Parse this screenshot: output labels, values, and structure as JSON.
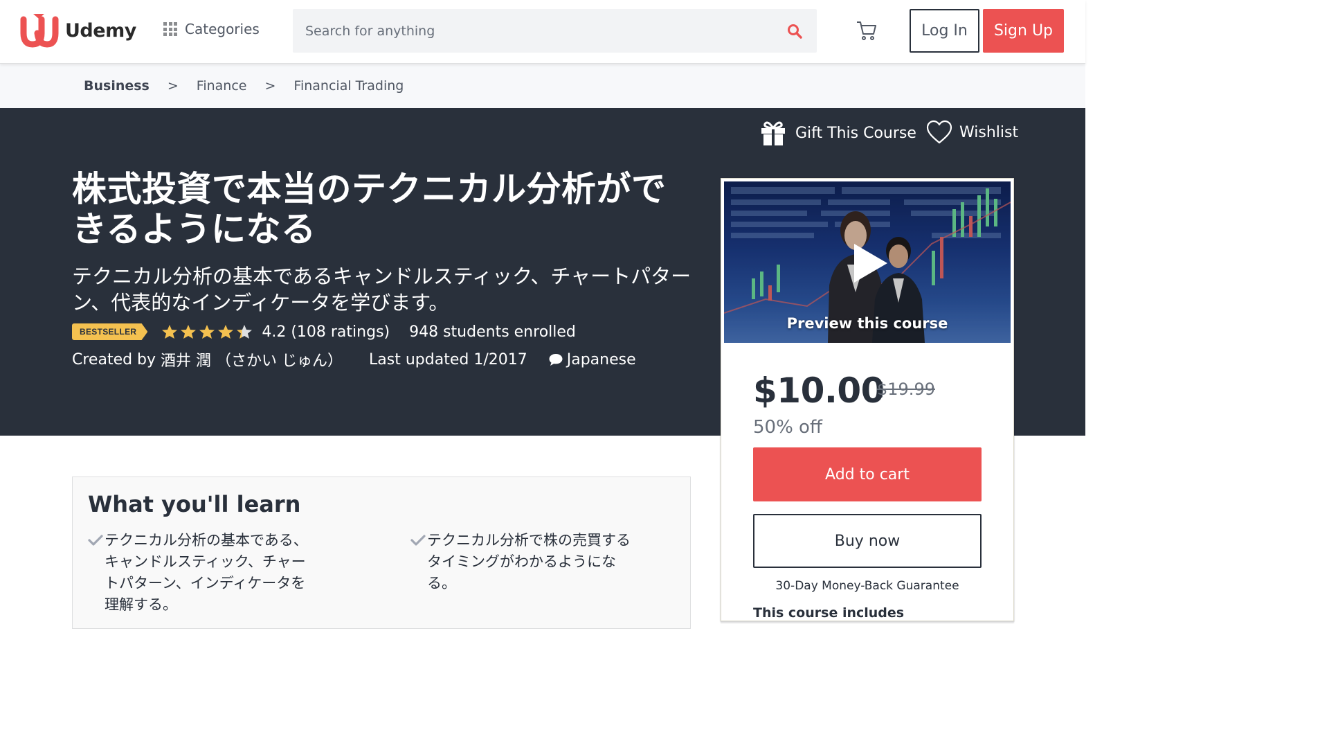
{
  "header": {
    "logo_text": "Udemy",
    "categories_label": "Categories",
    "search_placeholder": "Search for anything",
    "login_label": "Log In",
    "signup_label": "Sign Up",
    "accent_color": "#ec5252"
  },
  "breadcrumb": [
    {
      "label": "Business"
    },
    {
      "label": "Finance"
    },
    {
      "label": "Financial Trading"
    }
  ],
  "breadcrumb_separator": ">",
  "hero": {
    "gift_label": "Gift This Course",
    "wishlist_label": "Wishlist",
    "title": "株式投資で本当のテクニカル分析ができるようになる",
    "subtitle": "テクニカル分析の基本であるキャンドルスティック、チャートパターン、代表的なインディケータを学びます。",
    "badge": "BESTSELLER",
    "rating_value": 4.2,
    "rating_text": "4.2 (108 ratings)",
    "enrolled": "948 students enrolled",
    "created_by_label": "Created by",
    "instructor": "酒井 潤 （さかい じゅん）",
    "last_updated": "Last updated 1/2017",
    "language": "Japanese",
    "background_color": "#29303b",
    "star_color": "#f4c150"
  },
  "sidebar": {
    "preview_label": "Preview this course",
    "price": "$10.00",
    "original_price": "$19.99",
    "discount": "50% off",
    "add_to_cart_label": "Add to cart",
    "buy_now_label": "Buy now",
    "guarantee": "30-Day Money-Back Guarantee",
    "includes_label": "This course includes"
  },
  "learn": {
    "title": "What you'll learn",
    "items": [
      "テクニカル分析の基本である、キャンドルスティック、チャートパターン、インディケータを理解する。",
      "テクニカル分析で株の売買するタイミングがわかるようになる。"
    ]
  },
  "icons": [
    "udemy-logo-icon",
    "grid-icon",
    "search-icon",
    "cart-icon",
    "gift-icon",
    "heart-icon",
    "star-icon",
    "speech-bubble-icon",
    "play-icon",
    "check-icon"
  ]
}
